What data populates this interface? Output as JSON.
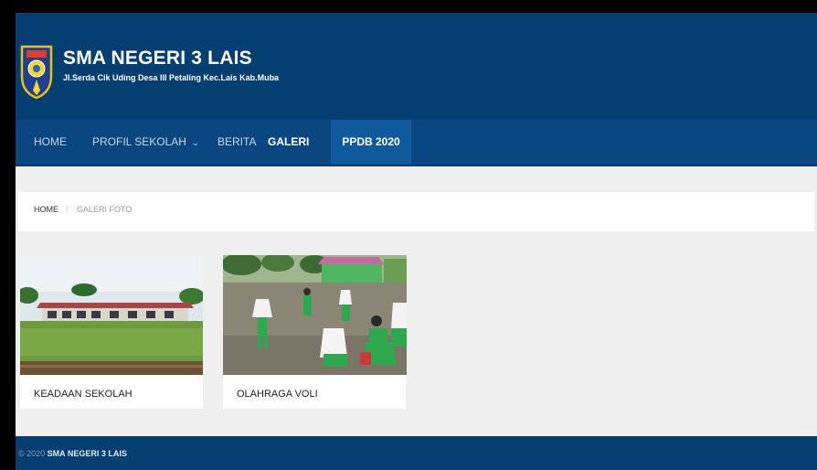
{
  "header": {
    "title": "SMA NEGERI 3 LAIS",
    "address": "Jl.Serda Cik Uding Desa III Petaling Kec.Lais Kab.Muba",
    "logo_icon": "school-crest-icon"
  },
  "nav": {
    "items": [
      {
        "label": "HOME"
      },
      {
        "label": "PROFIL SEKOLAH",
        "has_dropdown": true
      },
      {
        "label": "BERITA"
      },
      {
        "label": "GALERI"
      },
      {
        "label": "PPDB 2020"
      }
    ],
    "dropdown_glyph": "⌄"
  },
  "breadcrumb": {
    "home": "HOME",
    "separator": "/",
    "current": "GALERI FOTO"
  },
  "gallery": {
    "items": [
      {
        "title": "KEADAAN SEKOLAH",
        "image": "school-building-photo"
      },
      {
        "title": "OLAHRAGA VOLI",
        "image": "volleyball-students-photo"
      }
    ]
  },
  "footer": {
    "copyright": "© 2020",
    "name": "SMA NEGERI 3 LAIS"
  },
  "colors": {
    "header_bg": "#053e70",
    "nav_bg": "#0a4780",
    "nav_active_bg": "#0f5a9c",
    "page_bg": "#efefef"
  }
}
